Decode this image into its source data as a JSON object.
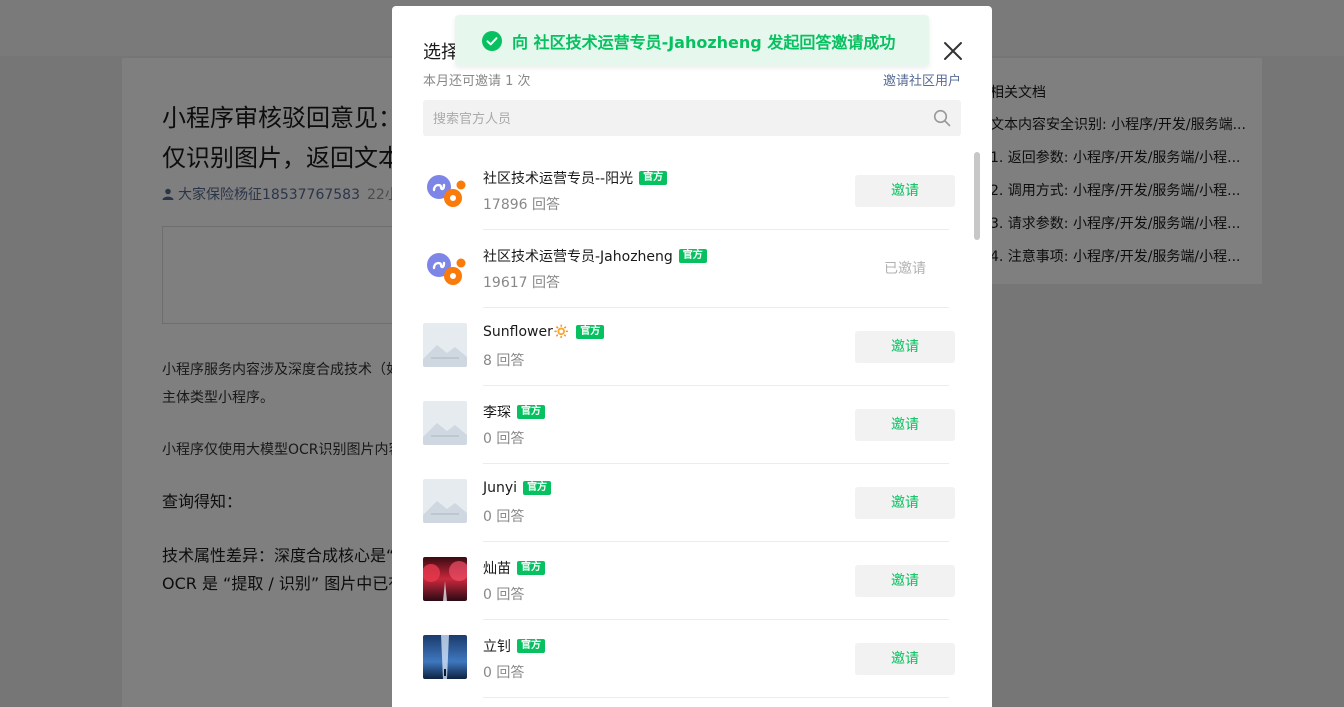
{
  "background": {
    "article_title": "小程序审核驳回意见：仅识别图片，返回文本",
    "author": "大家保险杨征18537767583",
    "time": "22小",
    "paragraph1": "小程序服务内容涉及深度合成技术（如",
    "paragraph1b": "主体类型小程序。",
    "paragraph2": "小程序仅使用大模型OCR识别图片内容",
    "heading1": "查询得知：",
    "heading2": "技术属性差异：深度合成核心是“",
    "heading3": "OCR 是 “提取 / 识别” 图片中已有",
    "side_title": "相关文档",
    "side_items": [
      "文本内容安全识别: 小程序/开发/服务端...",
      "1. 返回参数: 小程序/开发/服务端/小程...",
      "2. 调用方式: 小程序/开发/服务端/小程...",
      "3. 请求参数: 小程序/开发/服务端/小程...",
      "4. 注意事项: 小程序/开发/服务端/小程..."
    ]
  },
  "modal": {
    "title": "选择",
    "quota": "本月还可邀请 1 次",
    "invite_community": "邀请社区用户",
    "search_placeholder": "搜索官方人员",
    "members": [
      {
        "name": "社区技术运营专员--阳光",
        "badge": "官方",
        "answers": "17896 回答",
        "action": "邀请",
        "invited": false,
        "avatar": "miniprogram-logo"
      },
      {
        "name": "社区技术运营专员-Jahozheng",
        "badge": "官方",
        "answers": "19617 回答",
        "action": "已邀请",
        "invited": true,
        "avatar": "miniprogram-logo"
      },
      {
        "name": "Sunflower🔅",
        "badge": "官方",
        "answers": "8 回答",
        "action": "邀请",
        "invited": false,
        "avatar": "placeholder"
      },
      {
        "name": "李琛",
        "badge": "官方",
        "answers": "0 回答",
        "action": "邀请",
        "invited": false,
        "avatar": "placeholder"
      },
      {
        "name": "Junyi",
        "badge": "官方",
        "answers": "0 回答",
        "action": "邀请",
        "invited": false,
        "avatar": "placeholder"
      },
      {
        "name": "灿苗",
        "badge": "官方",
        "answers": "0 回答",
        "action": "邀请",
        "invited": false,
        "avatar": "red-landscape-photo"
      },
      {
        "name": "立钊",
        "badge": "官方",
        "answers": "0 回答",
        "action": "邀请",
        "invited": false,
        "avatar": "blue-light-photo"
      }
    ]
  },
  "toast": {
    "message": "向 社区技术运营专员-Jahozheng 发起回答邀请成功"
  },
  "colors": {
    "brand_green": "#07c160",
    "link_blue": "#576b95",
    "toast_bg": "#e6f7ee"
  }
}
